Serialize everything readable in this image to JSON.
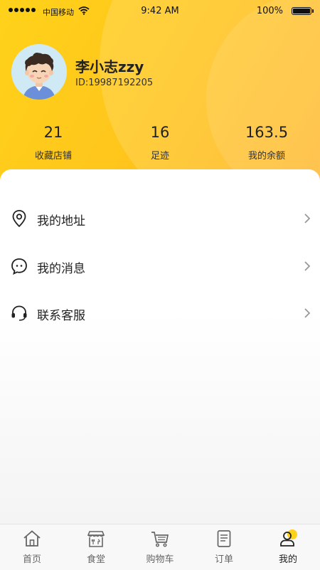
{
  "status_bar": {
    "carrier": "中国移动",
    "time": "9:42 AM",
    "battery": "100%"
  },
  "profile": {
    "name": "李小志zzy",
    "id": "ID:19987192205"
  },
  "stats": [
    {
      "value": "21",
      "label": "收藏店铺"
    },
    {
      "value": "16",
      "label": "足迹"
    },
    {
      "value": "163.5",
      "label": "我的余额"
    }
  ],
  "menu": [
    {
      "label": "我的地址",
      "icon": "location-pin-icon"
    },
    {
      "label": "我的消息",
      "icon": "chat-bubble-icon"
    },
    {
      "label": "联系客服",
      "icon": "headset-icon"
    }
  ],
  "tabs": [
    {
      "label": "首页",
      "icon": "home-icon"
    },
    {
      "label": "食堂",
      "icon": "canteen-icon"
    },
    {
      "label": "购物车",
      "icon": "cart-icon"
    },
    {
      "label": "订单",
      "icon": "order-icon"
    },
    {
      "label": "我的",
      "icon": "profile-icon",
      "active": true
    }
  ],
  "colors": {
    "header_gradient_start": "#ffd21a",
    "header_gradient_end": "#ffb21c",
    "accent": "#ffd21a"
  }
}
